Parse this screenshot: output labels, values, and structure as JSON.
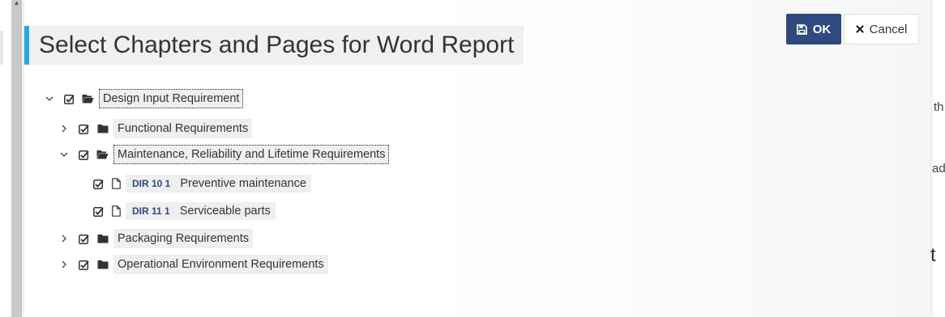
{
  "modal": {
    "title": "Select Chapters and Pages for Word Report",
    "ok_label": "OK",
    "cancel_label": "Cancel"
  },
  "tree": {
    "root": {
      "label": "Design Input Requirement",
      "expanded": true,
      "checked": true
    },
    "chapters": [
      {
        "label": "Functional Requirements",
        "expanded": false,
        "checked": true
      },
      {
        "label": "Maintenance, Reliability and Lifetime Requirements",
        "expanded": true,
        "checked": true,
        "pages": [
          {
            "code": "DIR 10 1",
            "title": "Preventive maintenance",
            "checked": true
          },
          {
            "code": "DIR 11 1",
            "title": "Serviceable parts",
            "checked": true
          }
        ]
      },
      {
        "label": "Packaging Requirements",
        "expanded": false,
        "checked": true
      },
      {
        "label": "Operational Environment Requirements",
        "expanded": false,
        "checked": true
      }
    ]
  },
  "background": {
    "fragment_1": "th",
    "fragment_2": "adi",
    "fragment_3": "t"
  },
  "colors": {
    "accent": "#29a8df",
    "primary_button": "#2e4a7e",
    "page_code": "#2e4a7e"
  }
}
